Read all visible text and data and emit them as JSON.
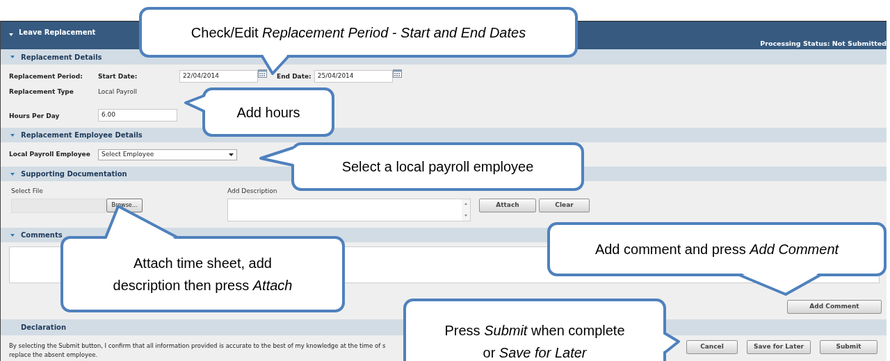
{
  "header": {
    "title": "Leave Replacement",
    "status": "Processing Status: Not Submitted"
  },
  "replacement_details": {
    "title": "Replacement Details",
    "expanded": true,
    "period_label": "Replacement Period:",
    "start_label": "Start Date:",
    "start_value": "22/04/2014",
    "end_label": "End Date:",
    "end_value": "25/04/2014",
    "type_label": "Replacement Type",
    "type_value": "Local Payroll",
    "hours_label": "Hours Per Day",
    "hours_value": "6.00"
  },
  "employee_details": {
    "title": "Replacement Employee Details",
    "expanded": true,
    "employee_label": "Local Payroll Employee",
    "employee_select": "Select Employee"
  },
  "documentation": {
    "title": "Supporting Documentation",
    "expanded": true,
    "file_label": "Select File",
    "browse_button": "Browse...",
    "description_label": "Add Description",
    "buttons": [
      "Attach",
      "Clear"
    ]
  },
  "comments": {
    "title": "Comments",
    "expanded": true,
    "add_button": "Add Comment"
  },
  "declaration": {
    "title": "Declaration",
    "text_lines": [
      "By selecting the Submit button, I confirm that all information provided is accurate to the best of my knowledge at the time of s",
      "replace the absent employee."
    ],
    "buttons": [
      "Cancel",
      "Save for Later",
      "Submit"
    ]
  },
  "callouts": [
    {
      "text": "Check/Edit *Replacement Period - Start and End Dates*"
    },
    {
      "text": "Add hours"
    },
    {
      "text": "Select a local payroll employee"
    },
    {
      "text": "Attach time sheet, add description then press *Attach*"
    },
    {
      "text": "Add comment and press *Add Comment*"
    },
    {
      "text": "Press *Submit* when complete or *Save for Later*"
    }
  ]
}
